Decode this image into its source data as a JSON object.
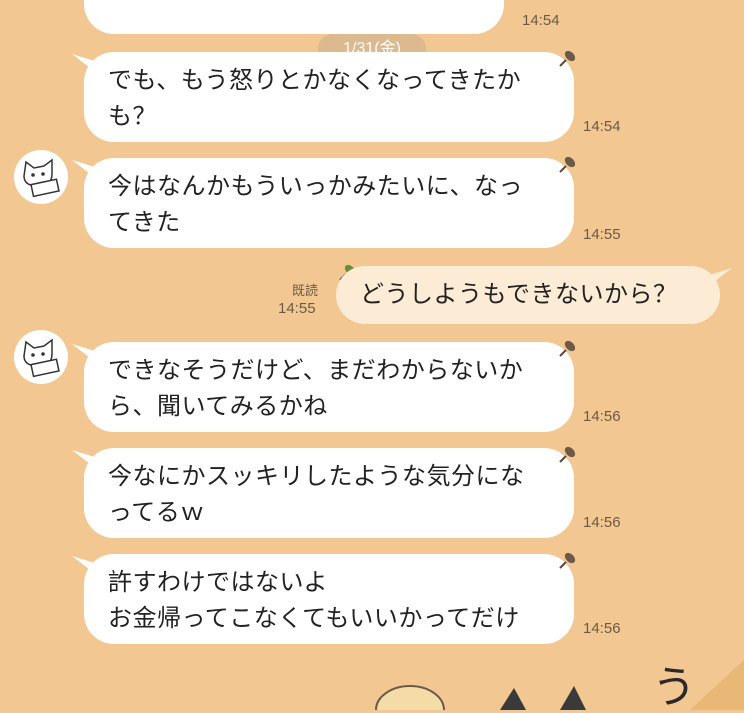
{
  "date_separator": "1/31(金)",
  "top_partial": {
    "time": "14:54"
  },
  "messages": [
    {
      "side": "left",
      "line1": "でも、もう怒りとかなくなってきたか",
      "line2": "も？",
      "time": "14:54"
    },
    {
      "side": "left",
      "line1": "今はなんかもういっかみたいに、なっ",
      "line2": "てきた",
      "time": "14:55"
    },
    {
      "side": "right",
      "text": "どうしようもできないから？",
      "read_label": "既読",
      "time": "14:55"
    },
    {
      "side": "left",
      "line1": "できなそうだけど、まだわからないか",
      "line2": "ら、聞いてみるかね",
      "time": "14:56"
    },
    {
      "side": "left",
      "line1": "今なにかスッキリしたような気分にな",
      "line2": "ってるｗ",
      "time": "14:56"
    },
    {
      "side": "left",
      "line1": "許すわけではないよ",
      "line2": "お金帰ってこなくてもいいかってだけ",
      "time": "14:56"
    }
  ],
  "avatar_icon": "cat-avatar-icon",
  "pin_icon": "pushpin-icon",
  "bottom_partial_char": "う",
  "colors": {
    "background": "#f2c792",
    "bubble_left": "#ffffff",
    "bubble_right": "#fcebd5"
  }
}
